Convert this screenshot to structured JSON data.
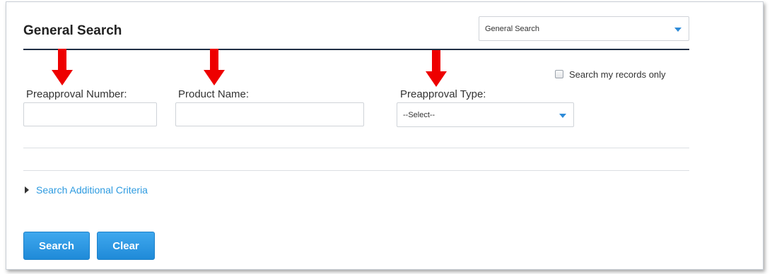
{
  "header": {
    "title": "General Search"
  },
  "search_type_select": {
    "selected": "General Search"
  },
  "search_my_records": {
    "label": "Search my records only",
    "checked": false
  },
  "fields": {
    "preapproval_number": {
      "label": "Preapproval Number:",
      "value": ""
    },
    "product_name": {
      "label": "Product Name:",
      "value": ""
    },
    "preapproval_type": {
      "label": "Preapproval Type:",
      "selected": "--Select--"
    }
  },
  "additional_criteria": {
    "label": "Search Additional Criteria"
  },
  "buttons": {
    "search": "Search",
    "clear": "Clear"
  },
  "colors": {
    "accent": "#2e9be0",
    "button": "#2b97e4",
    "title_rule": "#1f2f45",
    "annotation_arrow": "#ee0000"
  },
  "annotations": {
    "arrow_count": 3
  }
}
